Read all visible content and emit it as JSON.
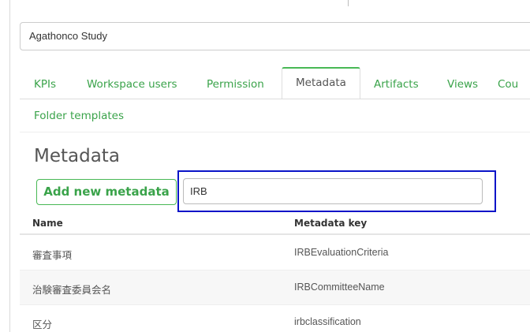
{
  "study": {
    "name": "Agathonco Study"
  },
  "tabs": [
    {
      "label": "KPIs",
      "active": false
    },
    {
      "label": "Workspace users",
      "active": false
    },
    {
      "label": "Permission",
      "active": false
    },
    {
      "label": "Metadata",
      "active": true
    },
    {
      "label": "Artifacts",
      "active": false
    },
    {
      "label": "Views",
      "active": false
    },
    {
      "label": "Cou",
      "active": false
    },
    {
      "label": "Folder templates",
      "active": false
    }
  ],
  "metadata": {
    "title": "Metadata",
    "add_button": "Add new metadata",
    "search_value": "IRB",
    "columns": {
      "name": "Name",
      "key": "Metadata key"
    },
    "rows": [
      {
        "name": "審査事項",
        "key": "IRBEvaluationCriteria"
      },
      {
        "name": "治験審査委員会名",
        "key": "IRBCommitteeName"
      },
      {
        "name": "区分",
        "key": "irbclassification"
      }
    ]
  },
  "colors": {
    "accent_green": "#48b855",
    "highlight_blue": "#0a14c8"
  }
}
